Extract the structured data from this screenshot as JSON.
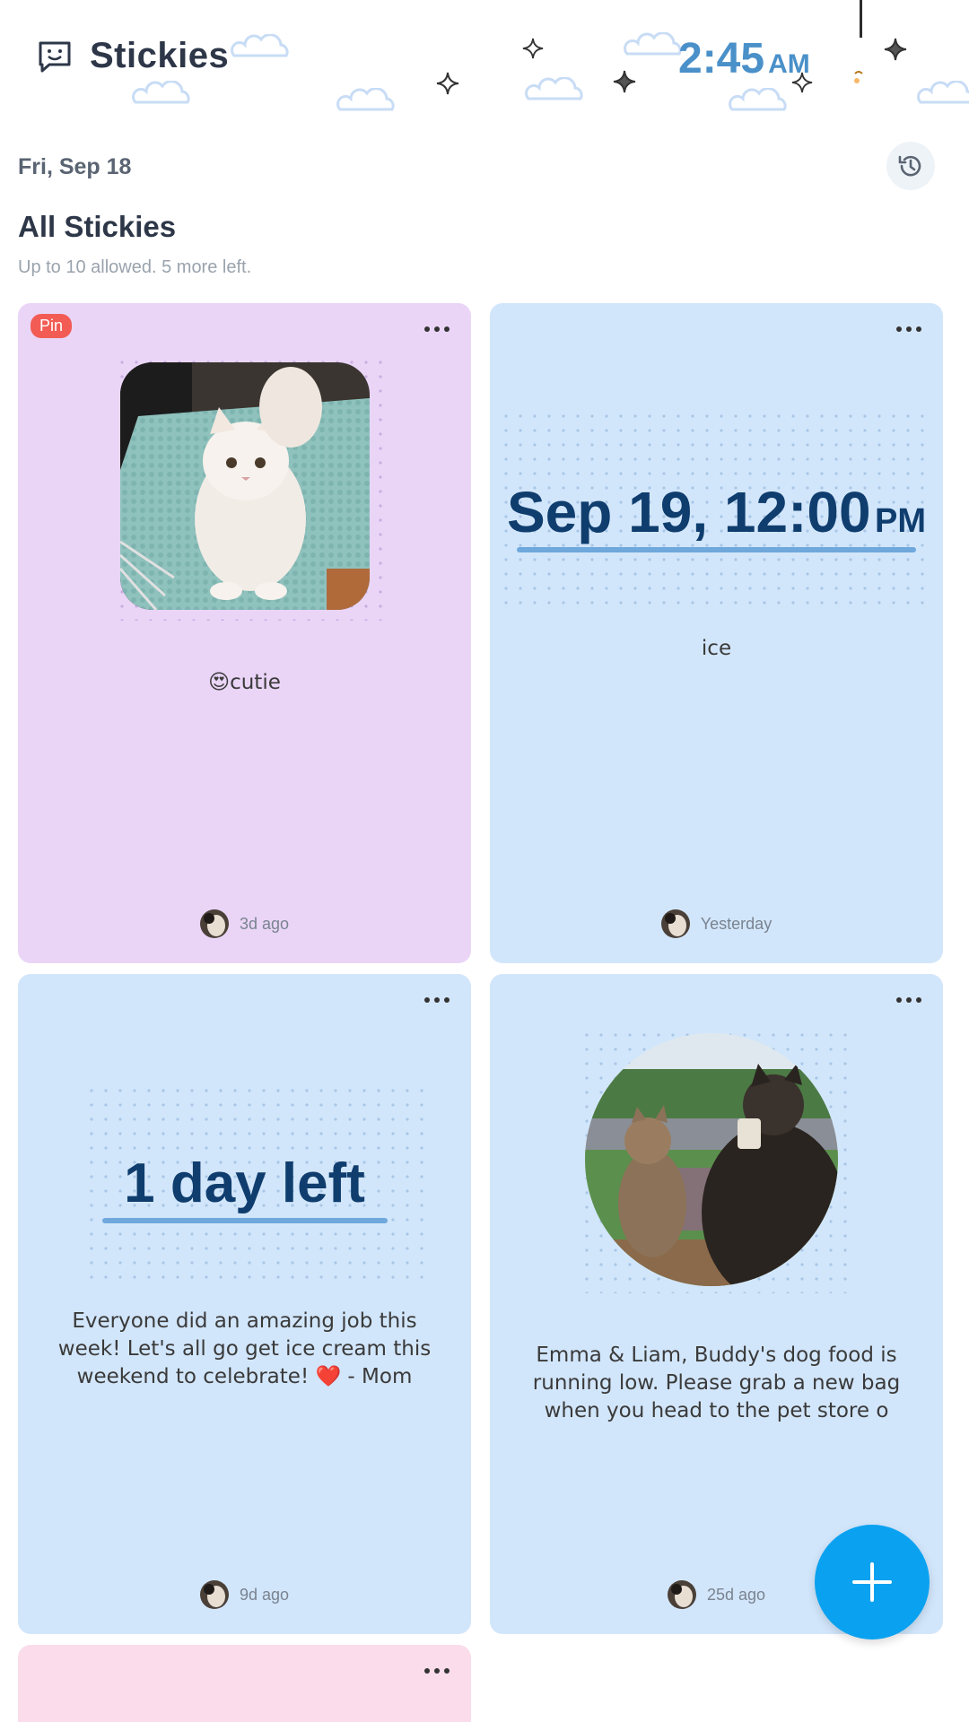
{
  "app": {
    "title": "Stickies"
  },
  "clock": {
    "time": "2:45",
    "ampm": "AM"
  },
  "date_label": "Fri, Sep 18",
  "section": {
    "title": "All Stickies",
    "subtitle": "Up to 10 allowed. 5 more left."
  },
  "cards": [
    {
      "badge": "Pin",
      "text": "😍cutie",
      "ago": "3d ago",
      "color": "#ead5f7"
    },
    {
      "date_main": "Sep 19, 12:00",
      "date_suffix": "PM",
      "text": "ice",
      "ago": "Yesterday",
      "color": "#d2e6fb"
    },
    {
      "countdown": "1 day left",
      "text": "Everyone did an amazing job this week! Let's all go get ice cream this weekend to celebrate! ❤️ - Mom",
      "ago": "9d ago",
      "color": "#d2e6fb"
    },
    {
      "text": "Emma & Liam, Buddy's dog food is running low. Please grab a new bag when you head to the pet store o",
      "ago": "25d ago",
      "color": "#d2e6fb"
    },
    {
      "color": "#fadcea"
    }
  ],
  "icons": {
    "app": "chat-smile-icon",
    "history": "history-icon",
    "more": "more-dots-icon",
    "add": "plus-icon",
    "moon": "moon-icon"
  },
  "colors": {
    "accent": "#0aa2f0",
    "pin": "#f25c54",
    "clock": "#4a90c9"
  }
}
